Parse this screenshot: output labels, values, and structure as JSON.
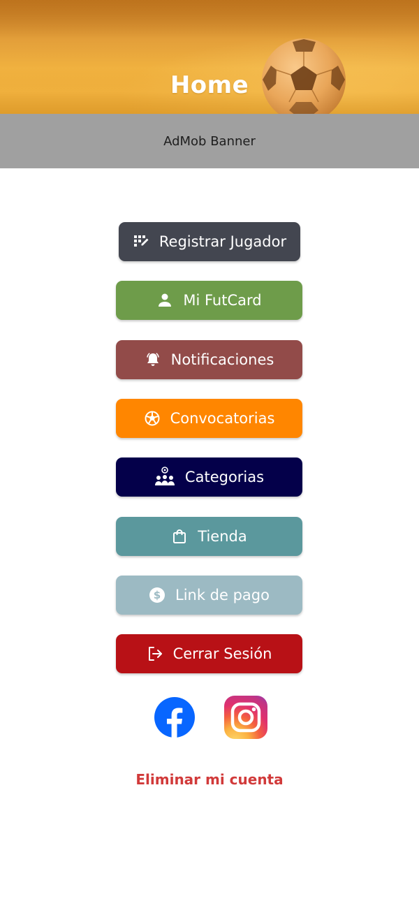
{
  "header": {
    "title": "Home"
  },
  "ad_banner": {
    "label": "AdMob Banner"
  },
  "menu": {
    "buttons": [
      {
        "label": "Registrar Jugador",
        "icon": "edit-grid-icon",
        "color": "#434650"
      },
      {
        "label": "Mi FutCard",
        "icon": "person-icon",
        "color": "#6e9c4a"
      },
      {
        "label": "Notificaciones",
        "icon": "alarm-bell-icon",
        "color": "#924b49"
      },
      {
        "label": "Convocatorias",
        "icon": "soccer-ball-icon",
        "color": "#ff8600"
      },
      {
        "label": "Categorias",
        "icon": "team-group-icon",
        "color": "#04004a"
      },
      {
        "label": "Tienda",
        "icon": "shopping-bag-icon",
        "color": "#5b989d"
      },
      {
        "label": "Link de pago",
        "icon": "dollar-coin-icon",
        "color": "#9cbac3"
      },
      {
        "label": "Cerrar Sesión",
        "icon": "logout-icon",
        "color": "#b81116"
      }
    ]
  },
  "social": {
    "facebook_icon": "facebook-icon",
    "instagram_icon": "instagram-icon",
    "facebook_color": "#0866ff"
  },
  "footer": {
    "delete_account": "Eliminar mi cuenta",
    "delete_color": "#d13a3a"
  }
}
